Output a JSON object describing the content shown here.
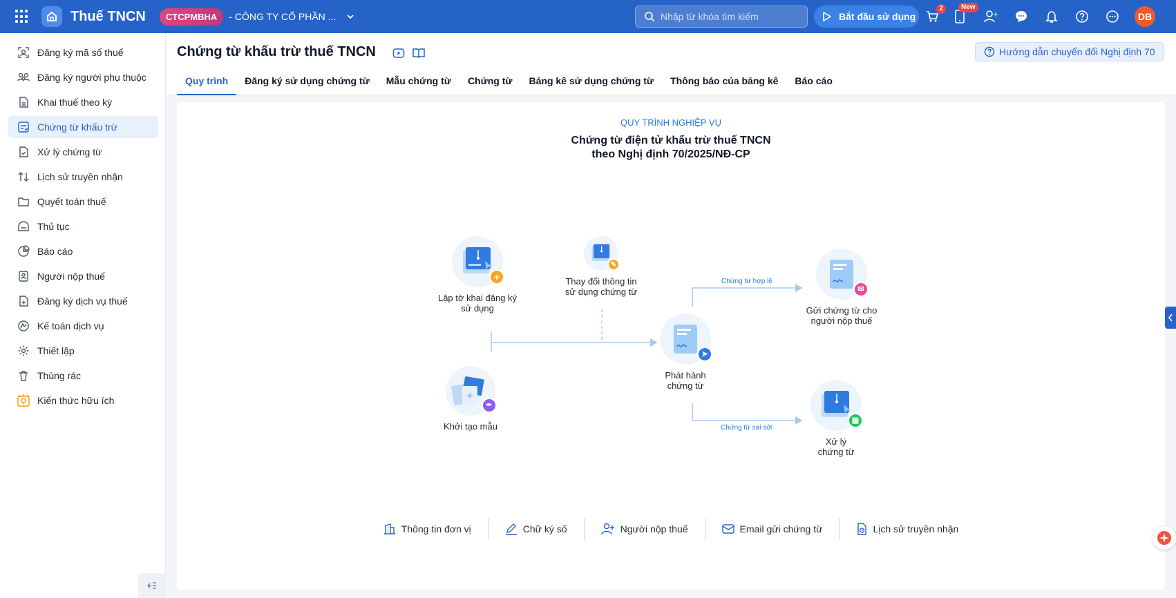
{
  "app": {
    "title": "Thuế TNCN",
    "company_code": "CTCPMBHA",
    "company_name": "- CÔNG TY CỔ PHẦN ..."
  },
  "search": {
    "placeholder": "Nhập từ khóa tìm kiếm"
  },
  "start_button": "Bắt đầu sử dụng",
  "cart_badge": "2",
  "mobile_badge": "New",
  "user_initials": "DB",
  "sidebar": {
    "items": [
      {
        "label": "Đăng ký mã số thuế",
        "icon": "id-scan-icon"
      },
      {
        "label": "Đăng ký người phụ thuộc",
        "icon": "users-icon"
      },
      {
        "label": "Khai thuế theo kỳ",
        "icon": "document-icon"
      },
      {
        "label": "Chứng từ khấu trừ",
        "icon": "voucher-icon"
      },
      {
        "label": "Xử lý chứng từ",
        "icon": "file-check-icon"
      },
      {
        "label": "Lịch sử truyền nhận",
        "icon": "transfer-icon"
      },
      {
        "label": "Quyết toán thuế",
        "icon": "folder-icon"
      },
      {
        "label": "Thủ tục",
        "icon": "procedure-icon"
      },
      {
        "label": "Báo cáo",
        "icon": "pie-chart-icon"
      },
      {
        "label": "Người nộp thuế",
        "icon": "person-card-icon"
      },
      {
        "label": "Đăng ký dịch vụ thuế",
        "icon": "register-service-icon"
      },
      {
        "label": "Kế toán dịch vụ",
        "icon": "accounting-icon"
      },
      {
        "label": "Thiết lập",
        "icon": "gear-icon"
      },
      {
        "label": "Thùng rác",
        "icon": "trash-icon"
      },
      {
        "label": "Kiến thức hữu ích",
        "icon": "lightbulb-icon"
      }
    ],
    "active_index": 3
  },
  "page": {
    "title": "Chứng từ khấu trừ thuế TNCN",
    "guide_button": "Hướng dẫn chuyển đổi Nghị định 70",
    "tabs": [
      "Quy trình",
      "Đăng ký sử dụng chứng từ",
      "Mẫu chứng từ",
      "Chứng từ",
      "Bảng kê sử dụng chứng từ",
      "Thông báo của bảng kê",
      "Báo cáo"
    ],
    "active_tab": 0
  },
  "process": {
    "label": "QUY TRÌNH NGHIỆP VỤ",
    "title_line1": "Chứng từ điện tử khấu trừ thuế TNCN",
    "title_line2": "theo Nghị định 70/2025/NĐ-CP",
    "nodes": {
      "register": [
        "Lập tờ khai đăng ký",
        "sử dụng"
      ],
      "change": [
        "Thay đổi thông tin",
        "sử dụng chứng từ"
      ],
      "template": [
        "Khởi tạo mẫu"
      ],
      "issue": [
        "Phát hành",
        "chứng từ"
      ],
      "send": [
        "Gửi chứng từ cho",
        "người nộp thuế"
      ],
      "handle": [
        "Xử lý",
        "chứng từ"
      ]
    },
    "flow_labels": {
      "valid": "Chứng từ hợp lệ",
      "error": "Chứng từ sai sót"
    }
  },
  "bottom_links": [
    "Thông tin đơn vị",
    "Chữ ký số",
    "Người nộp thuế",
    "Email gửi chứng từ",
    "Lịch sử truyền nhận"
  ]
}
